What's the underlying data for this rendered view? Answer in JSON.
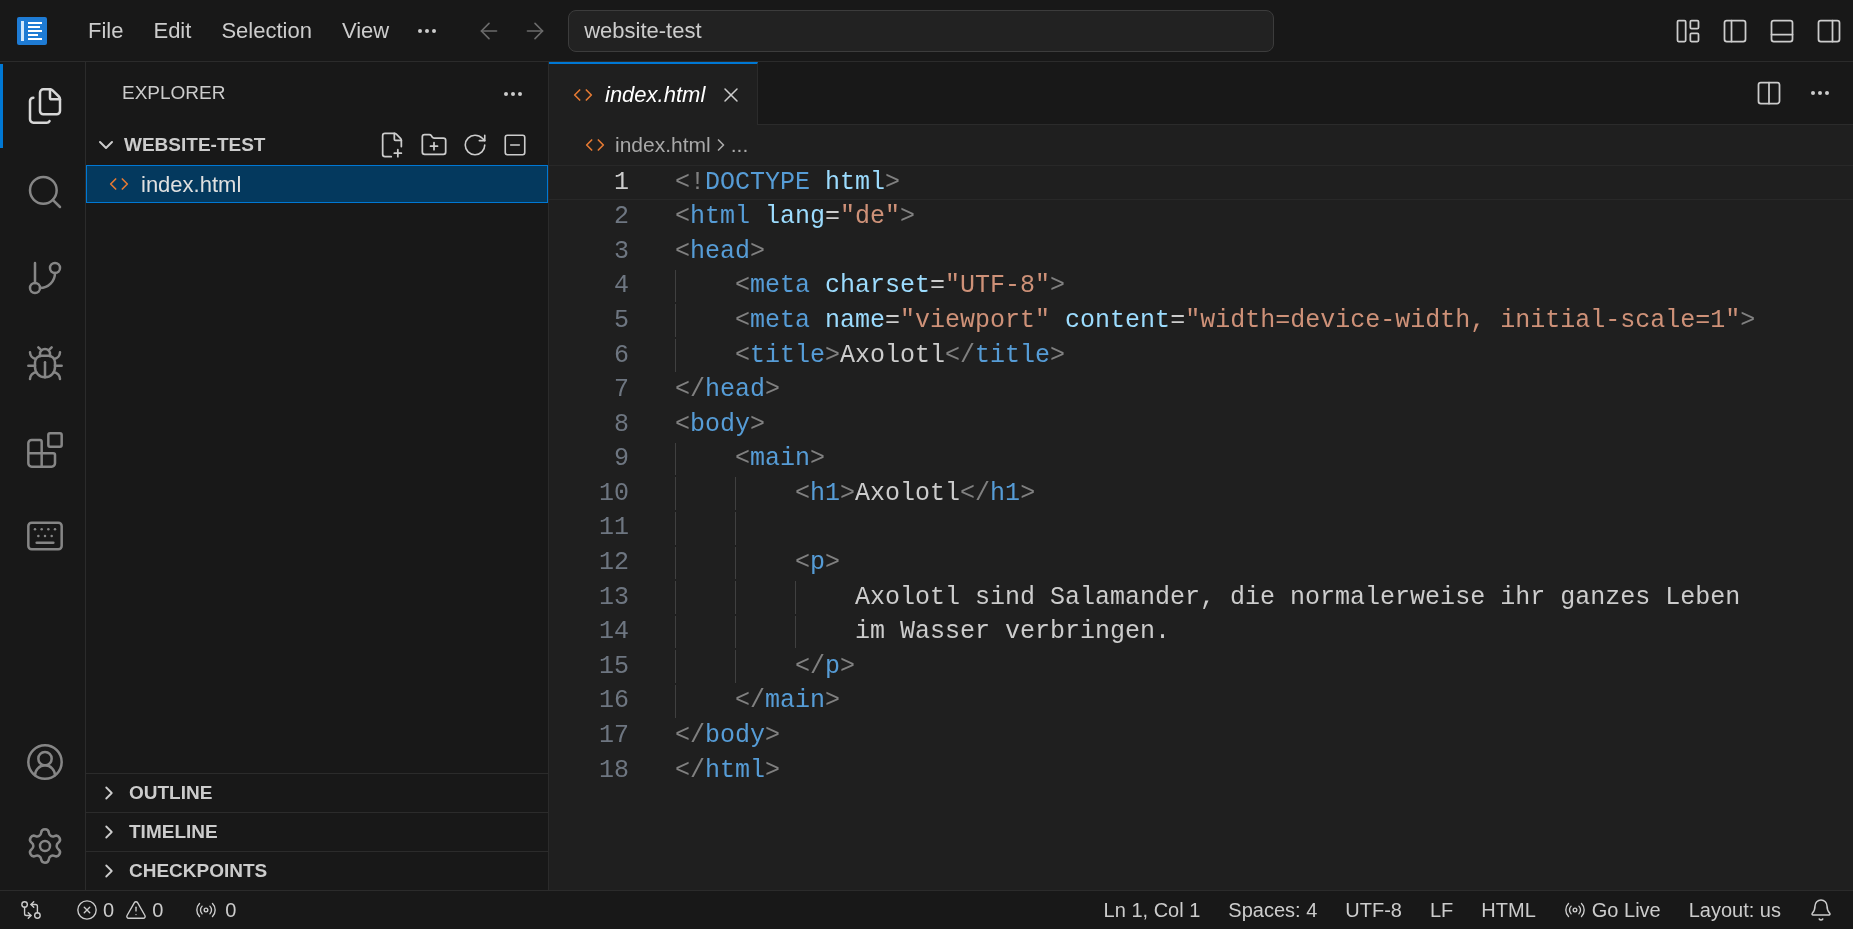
{
  "title_bar": {
    "menu": [
      "File",
      "Edit",
      "Selection",
      "View"
    ],
    "command_center": "website-test"
  },
  "activity_bar": {
    "items": [
      {
        "kind": "files",
        "selected": true
      },
      {
        "kind": "search",
        "selected": false
      },
      {
        "kind": "source-control",
        "selected": false
      },
      {
        "kind": "run-debug",
        "selected": false
      },
      {
        "kind": "extensions",
        "selected": false
      },
      {
        "kind": "keyboard",
        "selected": false
      }
    ],
    "bottom": [
      {
        "kind": "account"
      },
      {
        "kind": "settings"
      }
    ]
  },
  "sidebar": {
    "title": "EXPLORER",
    "folder": {
      "name": "WEBSITE-TEST",
      "expanded": true,
      "files": [
        {
          "name": "index.html",
          "selected": true
        }
      ]
    },
    "sections": [
      {
        "name": "OUTLINE",
        "expanded": false
      },
      {
        "name": "TIMELINE",
        "expanded": false
      },
      {
        "name": "CHECKPOINTS",
        "expanded": false
      }
    ]
  },
  "editor": {
    "tabs": [
      {
        "name": "index.html",
        "selected": true
      }
    ],
    "breadcrumb": [
      "index.html",
      "..."
    ],
    "lines": [
      {
        "number": "1",
        "current": true,
        "tokens": [
          {
            "kind": "punct",
            "text": "<!"
          },
          {
            "kind": "tag",
            "text": "DOCTYPE"
          },
          {
            "kind": "attr",
            "text": " html"
          },
          {
            "kind": "punct",
            "text": ">"
          }
        ]
      },
      {
        "number": "2",
        "current": false,
        "tokens": [
          {
            "kind": "punct",
            "text": "<"
          },
          {
            "kind": "tag",
            "text": "html"
          },
          {
            "kind": "attr",
            "text": " lang"
          },
          {
            "kind": "text",
            "text": "="
          },
          {
            "kind": "string",
            "text": "\"de\""
          },
          {
            "kind": "punct",
            "text": ">"
          }
        ]
      },
      {
        "number": "3",
        "current": false,
        "tokens": [
          {
            "kind": "punct",
            "text": "<"
          },
          {
            "kind": "tag",
            "text": "head"
          },
          {
            "kind": "punct",
            "text": ">"
          }
        ]
      },
      {
        "number": "4",
        "current": false,
        "tokens": [
          {
            "kind": "punct",
            "text": "    <"
          },
          {
            "kind": "tag",
            "text": "meta"
          },
          {
            "kind": "attr",
            "text": " charset"
          },
          {
            "kind": "text",
            "text": "="
          },
          {
            "kind": "string",
            "text": "\"UTF-8\""
          },
          {
            "kind": "punct",
            "text": ">"
          }
        ]
      },
      {
        "number": "5",
        "current": false,
        "tokens": [
          {
            "kind": "punct",
            "text": "    <"
          },
          {
            "kind": "tag",
            "text": "meta"
          },
          {
            "kind": "attr",
            "text": " name"
          },
          {
            "kind": "text",
            "text": "="
          },
          {
            "kind": "string",
            "text": "\"viewport\""
          },
          {
            "kind": "attr",
            "text": " content"
          },
          {
            "kind": "text",
            "text": "="
          },
          {
            "kind": "string",
            "text": "\"width=device-width, initial-scale=1\""
          },
          {
            "kind": "punct",
            "text": ">"
          }
        ]
      },
      {
        "number": "6",
        "current": false,
        "tokens": [
          {
            "kind": "punct",
            "text": "    <"
          },
          {
            "kind": "tag",
            "text": "title"
          },
          {
            "kind": "punct",
            "text": ">"
          },
          {
            "kind": "text",
            "text": "Axolotl"
          },
          {
            "kind": "punct",
            "text": "</"
          },
          {
            "kind": "tag",
            "text": "title"
          },
          {
            "kind": "punct",
            "text": ">"
          }
        ]
      },
      {
        "number": "7",
        "current": false,
        "tokens": [
          {
            "kind": "punct",
            "text": "</"
          },
          {
            "kind": "tag",
            "text": "head"
          },
          {
            "kind": "punct",
            "text": ">"
          }
        ]
      },
      {
        "number": "8",
        "current": false,
        "tokens": [
          {
            "kind": "punct",
            "text": "<"
          },
          {
            "kind": "tag",
            "text": "body"
          },
          {
            "kind": "punct",
            "text": ">"
          }
        ]
      },
      {
        "number": "9",
        "current": false,
        "tokens": [
          {
            "kind": "punct",
            "text": "    <"
          },
          {
            "kind": "tag",
            "text": "main"
          },
          {
            "kind": "punct",
            "text": ">"
          }
        ]
      },
      {
        "number": "10",
        "current": false,
        "tokens": [
          {
            "kind": "punct",
            "text": "        <"
          },
          {
            "kind": "tag",
            "text": "h1"
          },
          {
            "kind": "punct",
            "text": ">"
          },
          {
            "kind": "text",
            "text": "Axolotl"
          },
          {
            "kind": "punct",
            "text": "</"
          },
          {
            "kind": "tag",
            "text": "h1"
          },
          {
            "kind": "punct",
            "text": ">"
          }
        ]
      },
      {
        "number": "11",
        "current": false
      },
      {
        "number": "12",
        "current": false,
        "tokens": [
          {
            "kind": "punct",
            "text": "        <"
          },
          {
            "kind": "tag",
            "text": "p"
          },
          {
            "kind": "punct",
            "text": ">"
          }
        ]
      },
      {
        "number": "13",
        "current": false,
        "tokens": [
          {
            "kind": "text",
            "text": "            Axolotl sind Salamander, die normalerweise ihr ganzes Leben"
          }
        ]
      },
      {
        "number": "14",
        "current": false,
        "tokens": [
          {
            "kind": "text",
            "text": "            im Wasser verbringen."
          }
        ]
      },
      {
        "number": "15",
        "current": false,
        "tokens": [
          {
            "kind": "punct",
            "text": "        </"
          },
          {
            "kind": "tag",
            "text": "p"
          },
          {
            "kind": "punct",
            "text": ">"
          }
        ]
      },
      {
        "number": "16",
        "current": false,
        "tokens": [
          {
            "kind": "punct",
            "text": "    </"
          },
          {
            "kind": "tag",
            "text": "main"
          },
          {
            "kind": "punct",
            "text": ">"
          }
        ]
      },
      {
        "number": "17",
        "current": false,
        "tokens": [
          {
            "kind": "punct",
            "text": "</"
          },
          {
            "kind": "tag",
            "text": "body"
          },
          {
            "kind": "punct",
            "text": ">"
          }
        ]
      },
      {
        "number": "18",
        "current": false,
        "tokens": [
          {
            "kind": "punct",
            "text": "</"
          },
          {
            "kind": "tag",
            "text": "html"
          },
          {
            "kind": "punct",
            "text": ">"
          }
        ]
      }
    ]
  },
  "status_bar": {
    "errors": "0",
    "warnings": "0",
    "ports": "0",
    "items": [
      {
        "kind": "text",
        "text": "Ln 1, Col 1"
      },
      {
        "kind": "text",
        "text": "Spaces: 4"
      },
      {
        "kind": "text",
        "text": "UTF-8"
      },
      {
        "kind": "text",
        "text": "LF"
      },
      {
        "kind": "text",
        "text": "HTML"
      },
      {
        "kind": "live",
        "text": "Go Live"
      },
      {
        "kind": "text",
        "text": "Layout: us"
      }
    ]
  }
}
